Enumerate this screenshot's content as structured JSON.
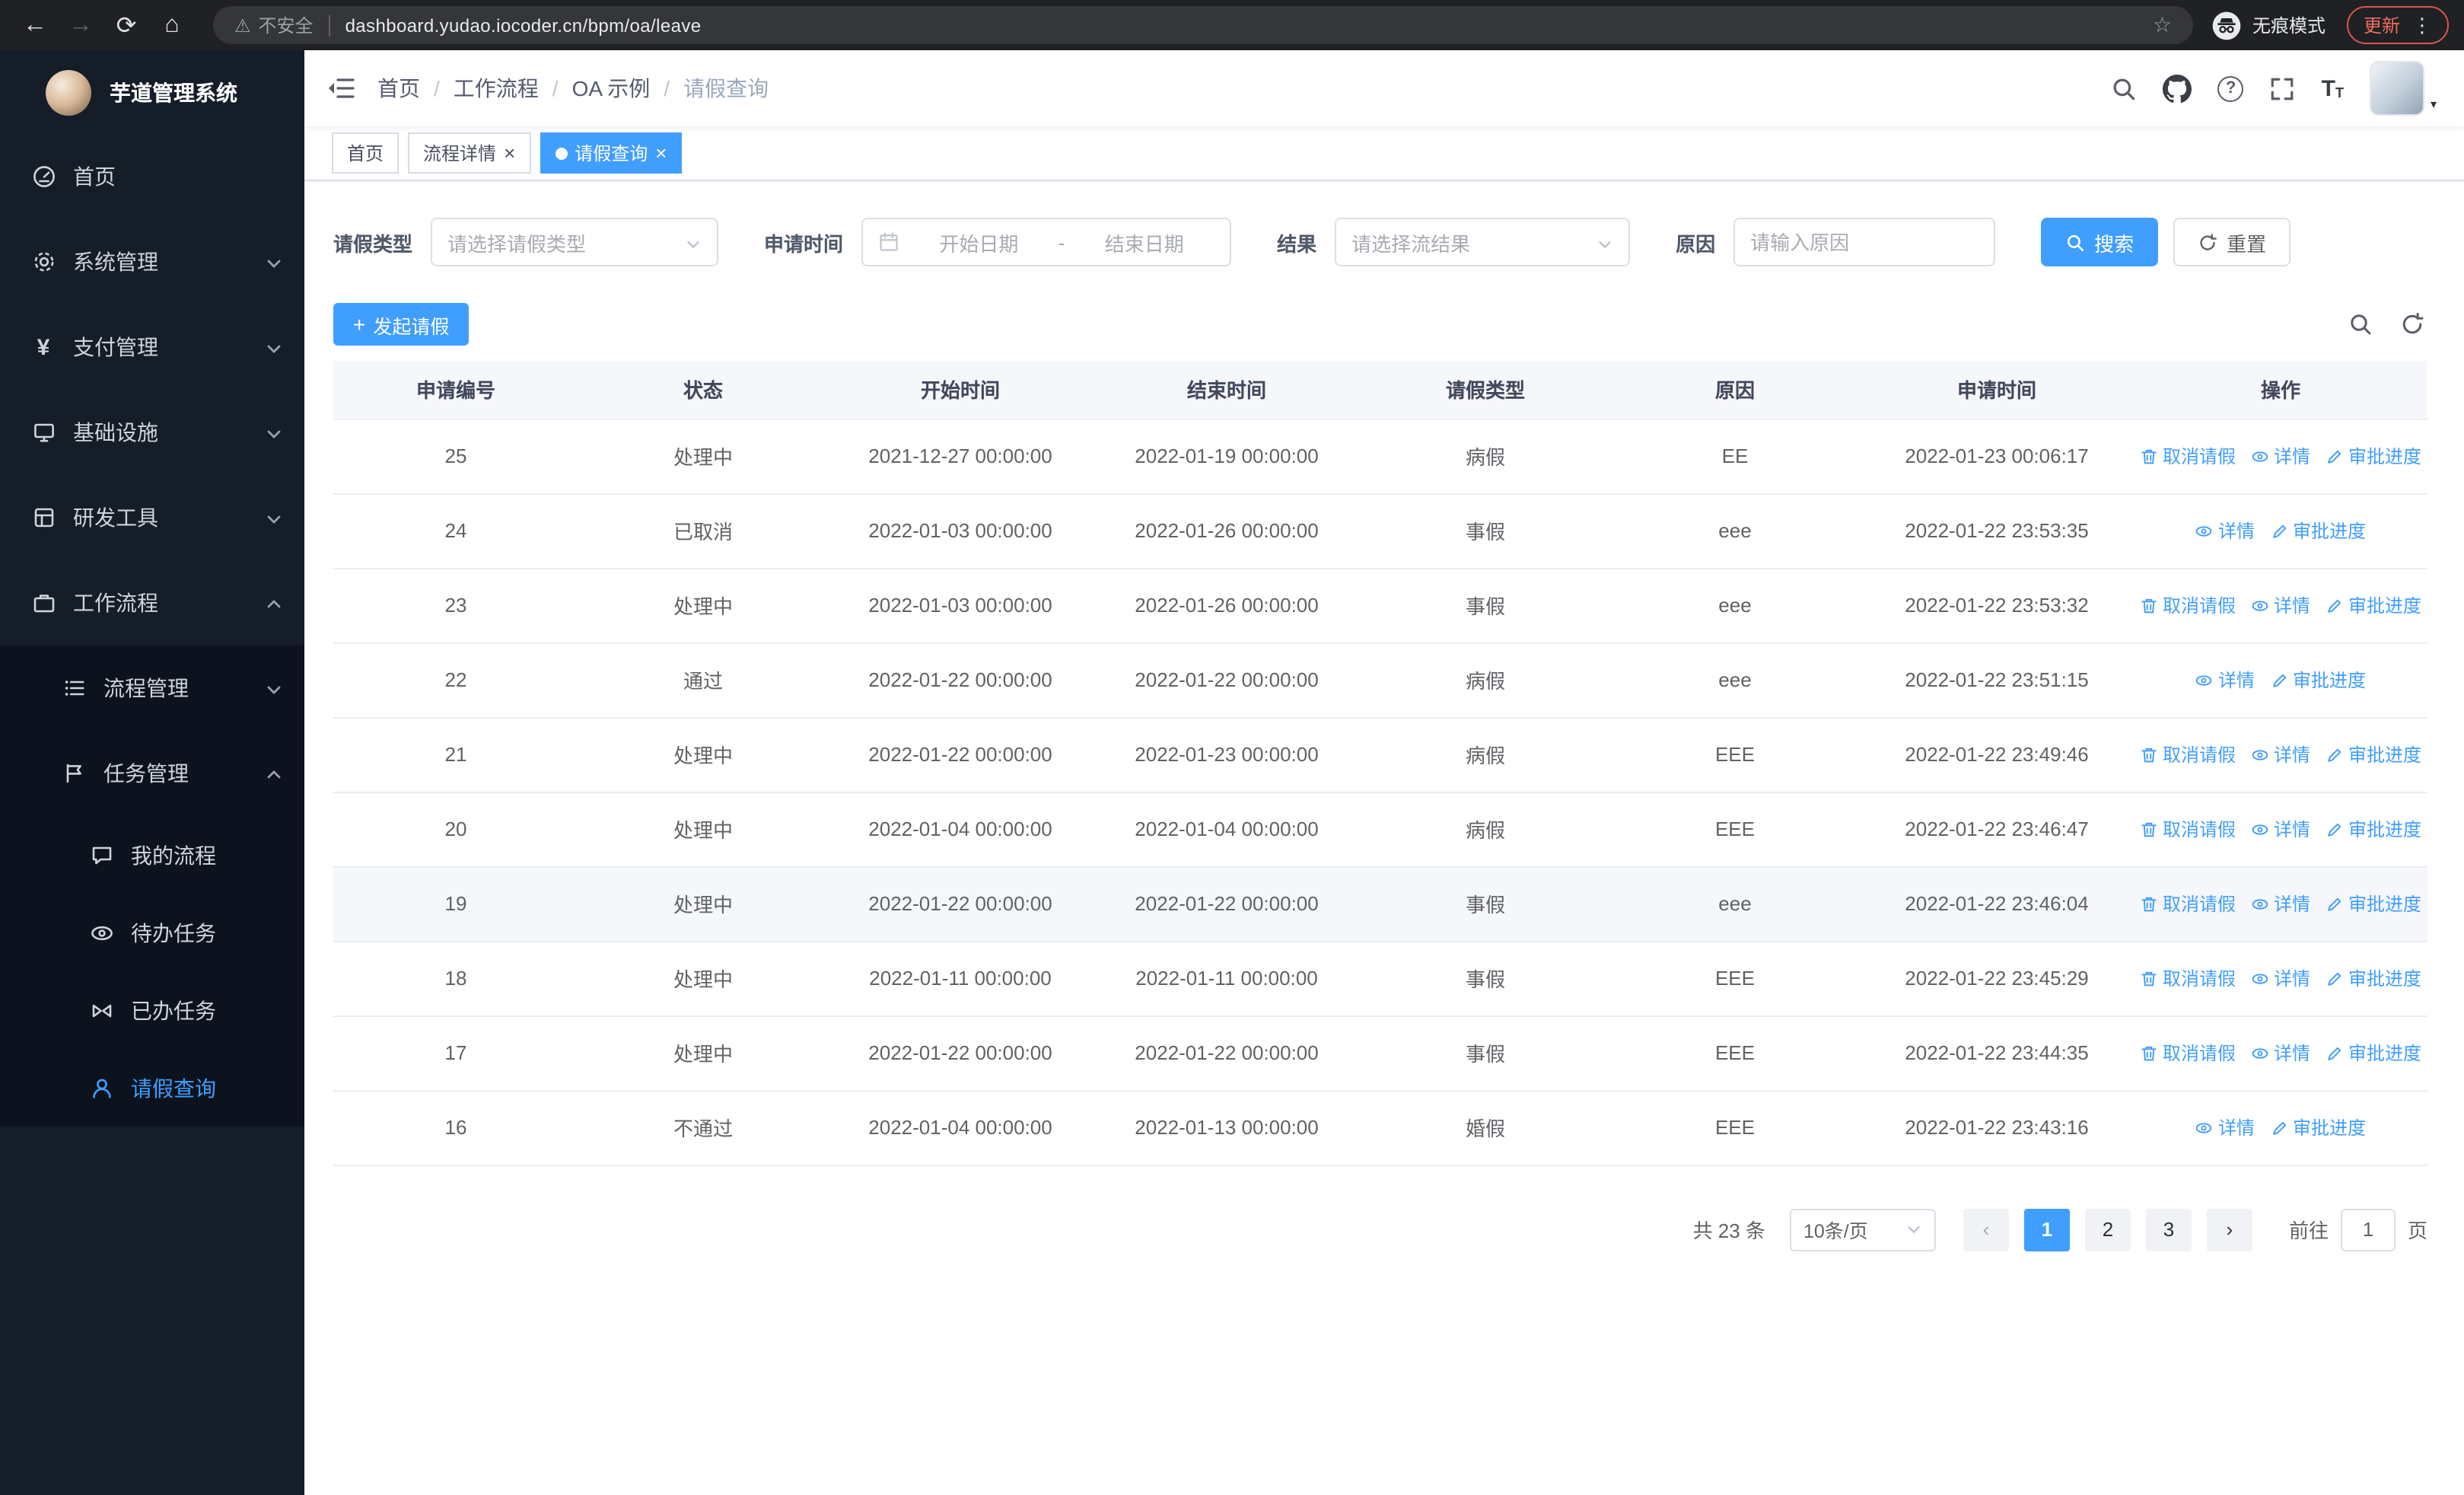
{
  "browser": {
    "security": "不安全",
    "url": "dashboard.yudao.iocoder.cn/bpm/oa/leave",
    "incognito": "无痕模式",
    "update": "更新"
  },
  "glyphs": {
    "back": "←",
    "forward": "→",
    "reload": "⟳",
    "home": "⌂",
    "warning": "⚠",
    "star": "☆",
    "menu_dots": "⋮",
    "close": "×",
    "plus": "+",
    "prev": "‹",
    "next": "›",
    "caret_down": "▾",
    "question": "?",
    "font_large": "T",
    "font_small": "T",
    "yen": "¥"
  },
  "sidebar": {
    "title": "芋道管理系统",
    "menu": [
      {
        "label": "首页",
        "icon": "dashboard-icon"
      },
      {
        "label": "系统管理",
        "icon": "gear-icon"
      },
      {
        "label": "支付管理",
        "icon": "yen-icon"
      },
      {
        "label": "基础设施",
        "icon": "monitor-icon"
      },
      {
        "label": "研发工具",
        "icon": "toolbox-icon"
      },
      {
        "label": "工作流程",
        "icon": "briefcase-icon"
      }
    ],
    "submenu": {
      "process": "流程管理",
      "task": "任务管理",
      "task_children": [
        "我的流程",
        "待办任务",
        "已办任务",
        "请假查询"
      ]
    },
    "active_item": "请假查询"
  },
  "header": {
    "breadcrumb": [
      "首页",
      "工作流程",
      "OA 示例",
      "请假查询"
    ],
    "breadcrumb_separator": "/"
  },
  "tabs": [
    {
      "label": "首页"
    },
    {
      "label": "流程详情",
      "closable": true
    },
    {
      "label": "请假查询",
      "closable": true,
      "active": true
    }
  ],
  "filters": {
    "type_label": "请假类型",
    "type_placeholder": "请选择请假类型",
    "time_label": "申请时间",
    "start_placeholder": "开始日期",
    "range_separator": "-",
    "end_placeholder": "结束日期",
    "result_label": "结果",
    "result_placeholder": "请选择流结果",
    "reason_label": "原因",
    "reason_placeholder": "请输入原因",
    "search": "搜索",
    "reset": "重置"
  },
  "toolbar": {
    "create": "发起请假"
  },
  "table": {
    "columns": [
      "申请编号",
      "状态",
      "开始时间",
      "结束时间",
      "请假类型",
      "原因",
      "申请时间",
      "操作"
    ],
    "actions": {
      "cancel": "取消请假",
      "detail": "详情",
      "progress": "审批进度"
    },
    "rows": [
      {
        "id": "25",
        "status": "处理中",
        "start": "2021-12-27 00:00:00",
        "end": "2022-01-19 00:00:00",
        "type": "病假",
        "reason": "EE",
        "applied": "2022-01-23 00:06:17",
        "cancelable": true
      },
      {
        "id": "24",
        "status": "已取消",
        "start": "2022-01-03 00:00:00",
        "end": "2022-01-26 00:00:00",
        "type": "事假",
        "reason": "eee",
        "applied": "2022-01-22 23:53:35"
      },
      {
        "id": "23",
        "status": "处理中",
        "start": "2022-01-03 00:00:00",
        "end": "2022-01-26 00:00:00",
        "type": "事假",
        "reason": "eee",
        "applied": "2022-01-22 23:53:32",
        "cancelable": true
      },
      {
        "id": "22",
        "status": "通过",
        "start": "2022-01-22 00:00:00",
        "end": "2022-01-22 00:00:00",
        "type": "病假",
        "reason": "eee",
        "applied": "2022-01-22 23:51:15"
      },
      {
        "id": "21",
        "status": "处理中",
        "start": "2022-01-22 00:00:00",
        "end": "2022-01-23 00:00:00",
        "type": "病假",
        "reason": "EEE",
        "applied": "2022-01-22 23:49:46",
        "cancelable": true
      },
      {
        "id": "20",
        "status": "处理中",
        "start": "2022-01-04 00:00:00",
        "end": "2022-01-04 00:00:00",
        "type": "病假",
        "reason": "EEE",
        "applied": "2022-01-22 23:46:47",
        "cancelable": true
      },
      {
        "id": "19",
        "status": "处理中",
        "start": "2022-01-22 00:00:00",
        "end": "2022-01-22 00:00:00",
        "type": "事假",
        "reason": "eee",
        "applied": "2022-01-22 23:46:04",
        "cancelable": true,
        "highlight": true
      },
      {
        "id": "18",
        "status": "处理中",
        "start": "2022-01-11 00:00:00",
        "end": "2022-01-11 00:00:00",
        "type": "事假",
        "reason": "EEE",
        "applied": "2022-01-22 23:45:29",
        "cancelable": true
      },
      {
        "id": "17",
        "status": "处理中",
        "start": "2022-01-22 00:00:00",
        "end": "2022-01-22 00:00:00",
        "type": "事假",
        "reason": "EEE",
        "applied": "2022-01-22 23:44:35",
        "cancelable": true
      },
      {
        "id": "16",
        "status": "不通过",
        "start": "2022-01-04 00:00:00",
        "end": "2022-01-13 00:00:00",
        "type": "婚假",
        "reason": "EEE",
        "applied": "2022-01-22 23:43:16"
      }
    ]
  },
  "pagination": {
    "total": "共 23 条",
    "page_size": "10条/页",
    "pages": [
      {
        "label": "1",
        "active": true
      },
      {
        "label": "2"
      },
      {
        "label": "3"
      }
    ],
    "goto_label": "前往",
    "goto_value": "1",
    "page_unit": "页"
  },
  "colors": {
    "primary": "#409eff",
    "sidebar_bg": "#151d29",
    "submenu_bg": "#0c131e",
    "chrome_bg": "#202124",
    "update_red": "#ee6c5f",
    "table_header_bg": "#f6f7fa"
  }
}
